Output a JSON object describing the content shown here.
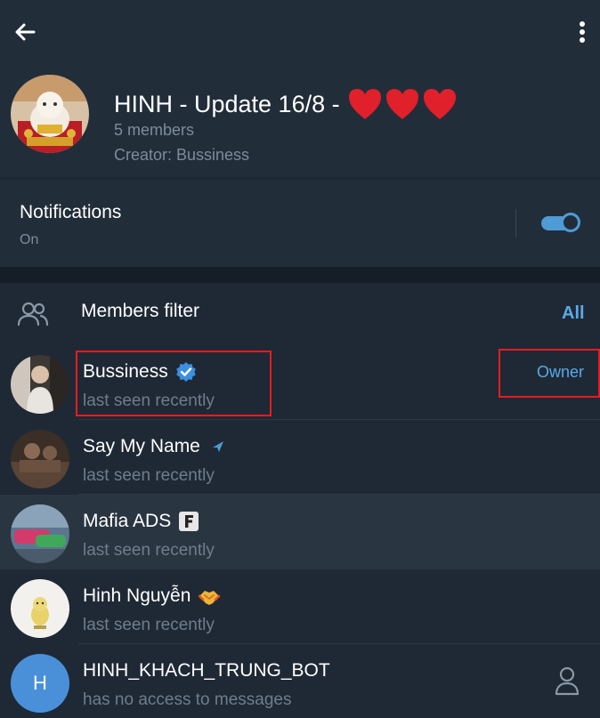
{
  "header": {
    "title": "HINH - Update 16/8 -",
    "members": "5 members",
    "creator": "Creator: Bussiness",
    "icons": {
      "back": "arrow-left-icon",
      "menu": "more-vertical-icon",
      "hearts": "red-heart-icon"
    }
  },
  "notifications": {
    "label": "Notifications",
    "value": "On",
    "toggle_on": true
  },
  "filter": {
    "label": "Members filter",
    "value": "All",
    "icon": "people-icon"
  },
  "members": [
    {
      "name": "Bussiness",
      "status": "last seen recently",
      "role": "Owner",
      "badge": "verified-icon"
    },
    {
      "name": "Say My Name",
      "status": "last seen recently",
      "badge": "send-arrow-icon"
    },
    {
      "name": "Mafia ADS",
      "status": "last seen recently",
      "badge": "letter-f-icon",
      "badge_text": "F"
    },
    {
      "name": "Hinh Nguyễn",
      "status": "last seen recently",
      "badge": "handshake-emoji-icon"
    },
    {
      "name": "HINH_KHACH_TRUNG_BOT",
      "status": "has no access to messages",
      "avatar_letter": "H",
      "action": "person-icon"
    }
  ],
  "colors": {
    "accent": "#5aa9e6",
    "background": "#1d2733",
    "highlight": "#e51c23",
    "bot_avatar": "#4a90d9"
  }
}
